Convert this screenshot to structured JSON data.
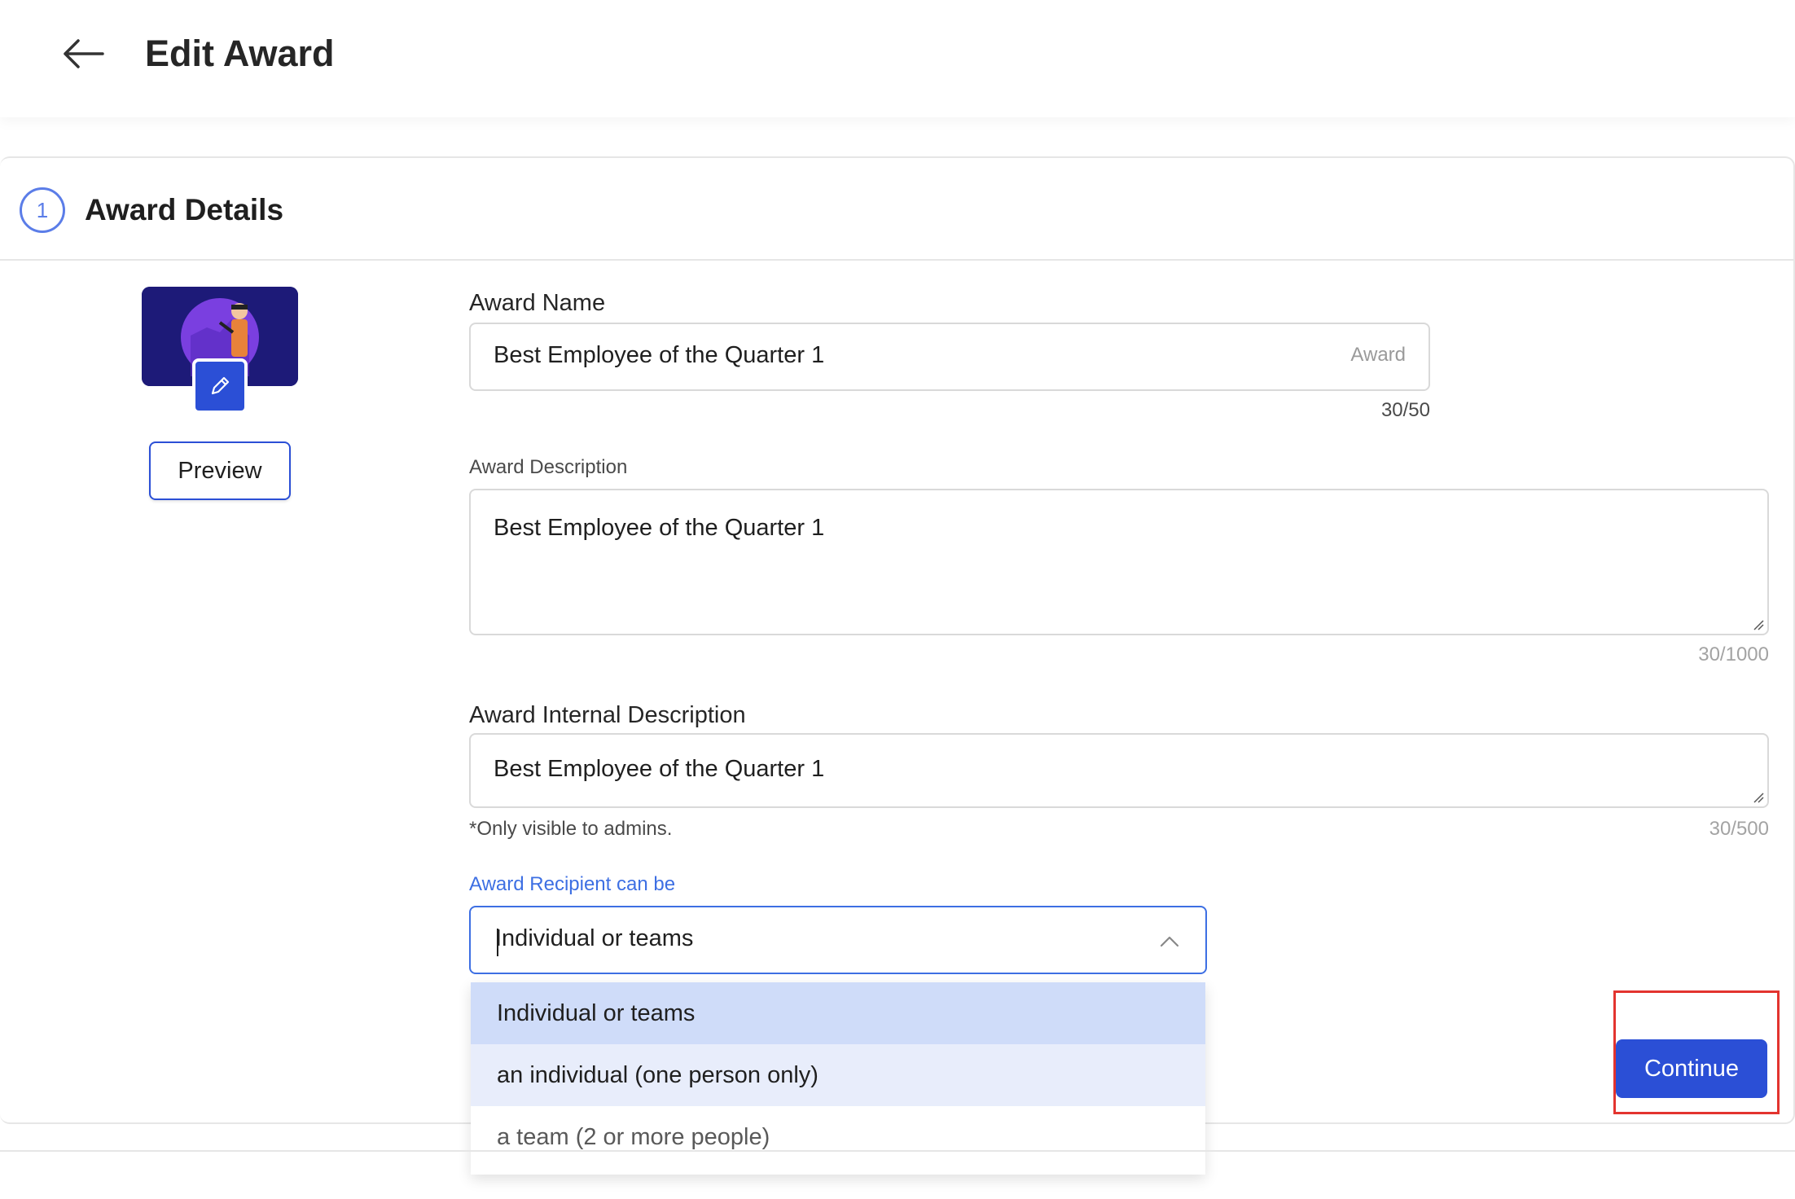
{
  "header": {
    "title": "Edit Award"
  },
  "section": {
    "step": "1",
    "title": "Award Details"
  },
  "image": {
    "preview_label": "Preview"
  },
  "award_name": {
    "label": "Award Name",
    "value": "Best Employee of the Quarter 1",
    "suffix": "Award",
    "counter": "30/50"
  },
  "award_description": {
    "label": "Award Description",
    "value": "Best Employee of the Quarter 1",
    "counter": "30/1000"
  },
  "internal_description": {
    "label": "Award Internal Description",
    "value": "Best Employee of the Quarter 1",
    "hint": "*Only visible to admins.",
    "counter": "30/500"
  },
  "recipient": {
    "label": "Award Recipient can be",
    "value": "Individual or teams",
    "options": [
      "Individual or teams",
      "an individual (one person only)",
      "a team (2 or more people)"
    ]
  },
  "actions": {
    "continue_label": "Continue"
  },
  "colors": {
    "primary": "#2b4fd6",
    "focus": "#3d6fe3",
    "selected_option": "#cfdcf9",
    "hover_option": "#e8edfb",
    "highlight": "#e3342f"
  },
  "icons": {
    "back": "arrow-left-icon",
    "edit": "pencil-icon",
    "dropdown": "chevron-up-icon"
  }
}
